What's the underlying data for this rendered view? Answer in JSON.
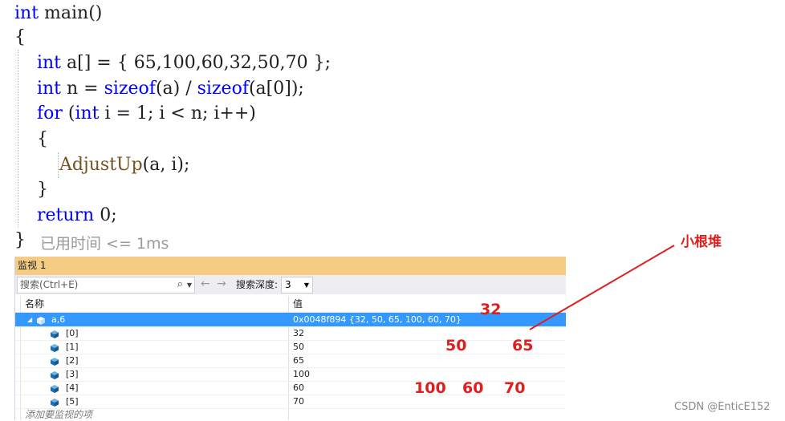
{
  "code": {
    "lines": [
      {
        "tokens": [
          {
            "t": "int",
            "c": "kw"
          },
          {
            "t": " main()",
            "c": ""
          }
        ]
      },
      {
        "tokens": [
          {
            "t": "{",
            "c": ""
          }
        ]
      },
      {
        "tokens": [
          {
            "t": "    int",
            "c": "kw"
          },
          {
            "t": " a[] = { 65,100,60,32,50,70 };",
            "c": ""
          }
        ]
      },
      {
        "tokens": [
          {
            "t": "    int",
            "c": "kw"
          },
          {
            "t": " n = ",
            "c": ""
          },
          {
            "t": "sizeof",
            "c": "kw"
          },
          {
            "t": "(a) / ",
            "c": ""
          },
          {
            "t": "sizeof",
            "c": "kw"
          },
          {
            "t": "(a[0]);",
            "c": ""
          }
        ]
      },
      {
        "tokens": [
          {
            "t": "    for",
            "c": "kw"
          },
          {
            "t": " (",
            "c": ""
          },
          {
            "t": "int",
            "c": "kw"
          },
          {
            "t": " i = 1; i < n; i++)",
            "c": ""
          }
        ]
      },
      {
        "tokens": [
          {
            "t": "    {",
            "c": ""
          }
        ]
      },
      {
        "tokens": [
          {
            "t": "        ",
            "c": ""
          },
          {
            "t": "AdjustUp",
            "c": "fn"
          },
          {
            "t": "(a, i);",
            "c": ""
          }
        ]
      },
      {
        "tokens": [
          {
            "t": "    }",
            "c": ""
          }
        ]
      },
      {
        "tokens": [
          {
            "t": "    return",
            "c": "kw"
          },
          {
            "t": " 0;",
            "c": ""
          }
        ]
      },
      {
        "tokens": [
          {
            "t": "}",
            "c": ""
          }
        ]
      }
    ],
    "elapsed": "已用时间 <= 1ms"
  },
  "watch": {
    "title": "监视 1",
    "search_placeholder": "搜索(Ctrl+E)",
    "search_icon": "magnifier-icon",
    "depth_label": "搜索深度:",
    "depth_value": "3",
    "col_name": "名称",
    "col_value": "值",
    "rows": [
      {
        "name": "a,6",
        "value": "0x0048f894 {32, 50, 65, 100, 60, 70}",
        "level": 0,
        "selected": true
      },
      {
        "name": "[0]",
        "value": "32",
        "level": 1,
        "selected": false
      },
      {
        "name": "[1]",
        "value": "50",
        "level": 1,
        "selected": false
      },
      {
        "name": "[2]",
        "value": "65",
        "level": 1,
        "selected": false
      },
      {
        "name": "[3]",
        "value": "100",
        "level": 1,
        "selected": false
      },
      {
        "name": "[4]",
        "value": "60",
        "level": 1,
        "selected": false
      },
      {
        "name": "[5]",
        "value": "70",
        "level": 1,
        "selected": false
      }
    ],
    "add_item": "添加要监视的项"
  },
  "annotation": {
    "title": "小根堆",
    "color": "#e01e1e",
    "heap_nodes": [
      "32",
      "50",
      "65",
      "100",
      "60",
      "70"
    ]
  },
  "watermark": "CSDN @EnticE152"
}
